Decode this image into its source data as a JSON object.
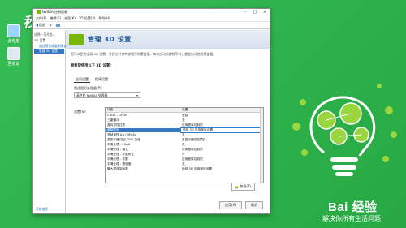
{
  "window": {
    "title": "NVIDIA 控制面板",
    "menu": [
      "文件(F)",
      "编辑(E)",
      "桌面(K)",
      "3D 设置(3)",
      "帮助(H)"
    ],
    "toolbar": {
      "back": "后退",
      "forward": ""
    },
    "task_header": "选择一项任务...",
    "sidebar": {
      "section": "3D 设置",
      "items": [
        "通过预览调整图像设置",
        "管理 3D 设置"
      ],
      "system_info": "系统信息"
    },
    "header_title": "管理 3D 设置",
    "description": "您可以更改全局 3D 设置，并建立针对特定程序的覆盖值。每次启动指定程序时，都会自动使用覆盖值。",
    "subheading": "我希望使用以下 3D 设置：",
    "tabs": [
      "全局设置",
      "程序设置"
    ],
    "processor_label": "首选图形处理器(P)：",
    "processor_value": "高性能 NVIDIA 处理器",
    "settings_label": "设置(S)：",
    "grid_header": [
      "功能",
      "设置"
    ],
    "grid_rows": [
      [
        "CUDA - GPUs",
        "全部"
      ],
      [
        "三重缓冲",
        "关"
      ],
      [
        "各向异性过滤",
        "应用程序控制的"
      ],
      [
        "垂直同步",
        "使用 3D 应用程序设置"
      ],
      [
        "多帧采样 AA (MFAA)",
        "关"
      ],
      [
        "多显示器/混合 GPU 加速",
        "多显示器性能模式"
      ],
      [
        "平滑处理 - FXAA",
        "关"
      ],
      [
        "平滑处理 - 模式",
        "应用程序控制的"
      ],
      [
        "平滑处理 - 灰度纠正",
        "开"
      ],
      [
        "平滑处理 - 设置",
        "应用程序控制的"
      ],
      [
        "平滑处理 - 透明度",
        "关"
      ],
      [
        "最大预渲染帧数",
        "使用 3D 应用程序设置"
      ]
    ],
    "highlight_row": 3,
    "restore_button": "恢复(T)",
    "apply_button": "应用(A)",
    "cancel_button": "取消"
  },
  "desktop_icons": [
    {
      "label": "此电脑"
    },
    {
      "label": "回收站"
    }
  ],
  "watermark_top": "秒懂视频",
  "brand": {
    "logo": "Bai 经验",
    "tagline": "解决你所有生活问题"
  },
  "colors": {
    "desktop_green": "#2db24a",
    "nvidia_green": "#76b900",
    "selection_blue": "#3478c5"
  }
}
